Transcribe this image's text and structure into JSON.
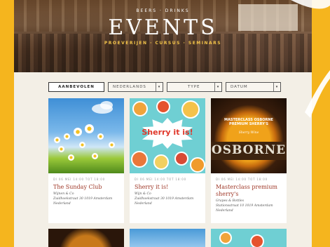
{
  "hero": {
    "overtitle": "BEERS · DRINKS",
    "title": "EVENTS",
    "subtitle": "PROEVERIJEN · CURSUS · SEMINARS"
  },
  "filters": {
    "active_label": "AANBEVOLEN",
    "options": [
      {
        "label": "NEDERLANDS"
      },
      {
        "label": "TYPE"
      },
      {
        "label": "DATUM"
      }
    ]
  },
  "cards": [
    {
      "date": "DI 06 MEI 14:00 TOT 18:00",
      "title": "The Sunday Club",
      "venue": "Wijnen & Co",
      "address": "Zuidhoekstraat 30 1019 Amsterdam Nederland",
      "image": "daisy-field"
    },
    {
      "date": "DI 06 MEI 14:00 TOT 18:00",
      "title": "Sherry it is!",
      "venue": "Wijn & Co",
      "address": "Zuidhoekstraat 30 1019 Amsterdam Nederland",
      "image_text": "Sherry it is!"
    },
    {
      "date": "DI 06 MEI 14:00 TOT 18:00",
      "title": "Masterclass premium sherry's",
      "venue": "Grapes & Bottles",
      "address": "Stationsstraat 10 1019 Amsterdam Nederland",
      "image_lines": [
        "MASTERCLASS OSBORNE",
        "PREMIUM SHERRY'S"
      ],
      "image_sub": "Sherry Wine",
      "brand": "OSBORNE"
    }
  ],
  "colors": {
    "frame": "#f5b51e",
    "panel": "#f3efe6",
    "title_red": "#a03a2a"
  }
}
